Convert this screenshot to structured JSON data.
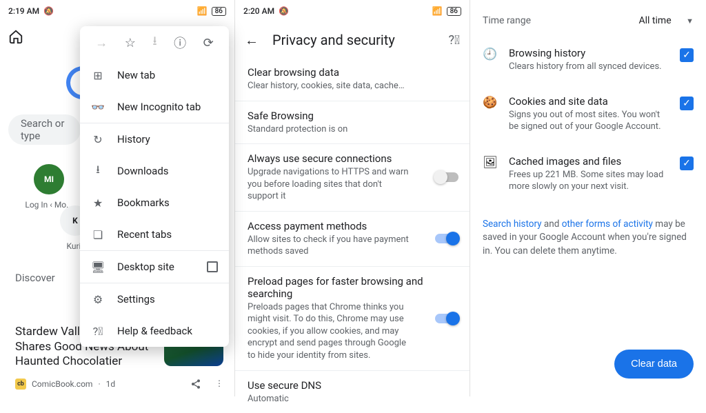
{
  "panel_a": {
    "status": {
      "time": "2:19 AM",
      "battery": "86"
    },
    "search_placeholder": "Search or type",
    "tiles": [
      {
        "label": "Log In ‹ Mo..."
      },
      {
        "label": "Kurir"
      }
    ],
    "discover_label": "Discover",
    "article": {
      "title": "Stardew Valley Developer Shares Good News About Haunted Chocolatier",
      "source": "ComicBook.com",
      "age": "1d"
    }
  },
  "dropdown": {
    "items": [
      {
        "label": "New tab"
      },
      {
        "label": "New Incognito tab"
      },
      {
        "label": "History"
      },
      {
        "label": "Downloads"
      },
      {
        "label": "Bookmarks"
      },
      {
        "label": "Recent tabs"
      },
      {
        "label": "Desktop site"
      },
      {
        "label": "Settings"
      },
      {
        "label": "Help & feedback"
      }
    ]
  },
  "panel_b": {
    "status": {
      "time": "2:20 AM",
      "battery": "86"
    },
    "title": "Privacy and security",
    "settings": [
      {
        "title": "Clear browsing data",
        "sub": "Clear history, cookies, site data, cache…"
      },
      {
        "title": "Safe Browsing",
        "sub": "Standard protection is on"
      },
      {
        "title": "Always use secure connections",
        "sub": "Upgrade navigations to HTTPS and warn you before loading sites that don't support it",
        "toggle": false
      },
      {
        "title": "Access payment methods",
        "sub": "Allow sites to check if you have payment methods saved",
        "toggle": true
      },
      {
        "title": "Preload pages for faster browsing and searching",
        "sub": "Preloads pages that Chrome thinks you might visit. To do this, Chrome may use cookies, if you allow cookies, and may encrypt and send pages through Google to hide your identity from sites.",
        "toggle": true
      },
      {
        "title": "Use secure DNS",
        "sub": "Automatic"
      }
    ]
  },
  "panel_c": {
    "time_range_label": "Time range",
    "time_range_value": "All time",
    "checks": [
      {
        "title": "Browsing history",
        "desc": "Clears history from all synced devices."
      },
      {
        "title": "Cookies and site data",
        "desc": "Signs you out of most sites. You won't be signed out of your Google Account."
      },
      {
        "title": "Cached images and files",
        "desc": "Frees up 221 MB. Some sites may load more slowly on your next visit."
      }
    ],
    "note_link1": "Search history",
    "note_mid": " and ",
    "note_link2": "other forms of activity",
    "note_tail": " may be saved in your Google Account when you're signed in. You can delete them anytime.",
    "clear_button": "Clear data"
  }
}
